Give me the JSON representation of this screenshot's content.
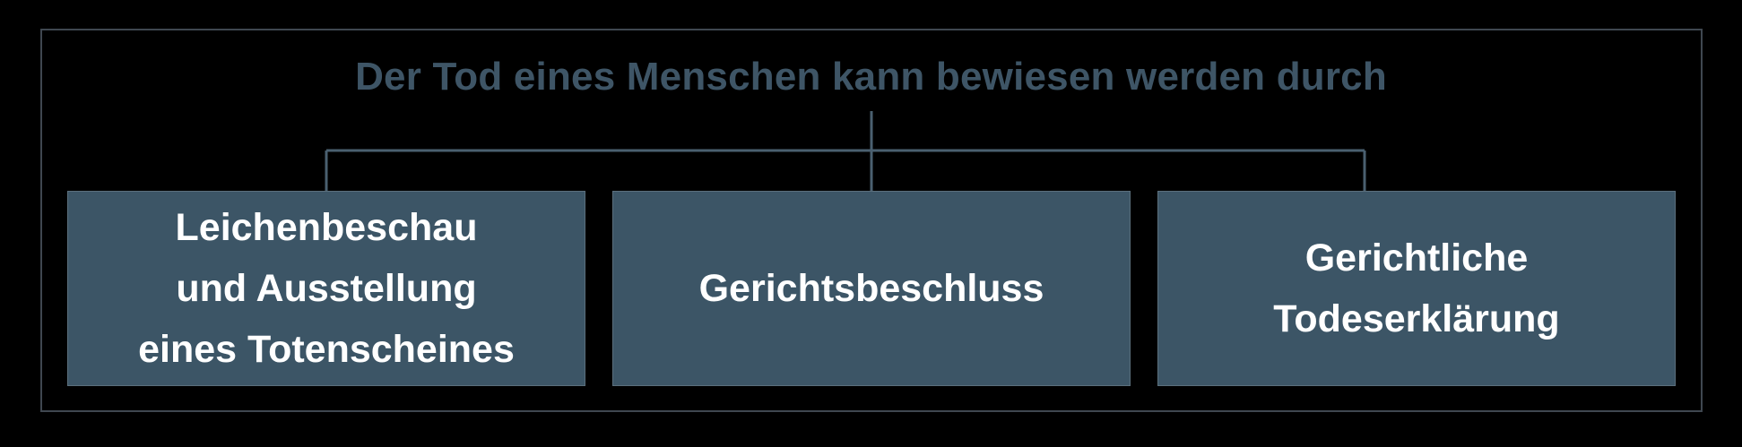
{
  "diagram": {
    "title": "Der Tod eines Menschen kann bewiesen werden durch",
    "boxes": [
      {
        "label": "Leichenbeschau\nund Ausstellung\neines Totenscheines"
      },
      {
        "label": "Gerichtsbeschluss"
      },
      {
        "label": "Gerichtliche\nTodeserklärung"
      }
    ]
  },
  "colors": {
    "background": "#000000",
    "title": "#3e5566",
    "box_fill": "#3c5566",
    "box_text": "#ffffff",
    "connector": "#4a6070",
    "frame": "#3f4750"
  }
}
